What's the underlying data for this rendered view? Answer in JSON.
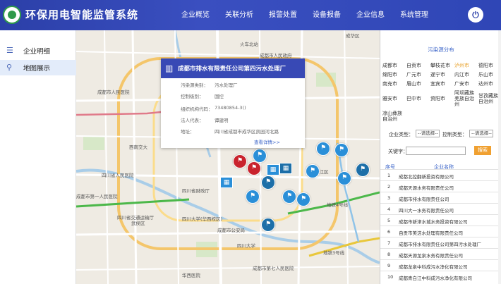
{
  "header": {
    "title": "环保用电智能监管系统",
    "nav": [
      "企业概览",
      "关联分析",
      "报警处置",
      "设备报备",
      "企业信息",
      "系统管理"
    ]
  },
  "sidebar": {
    "items": [
      {
        "label": "企业明细",
        "icon": "list-icon"
      },
      {
        "label": "地图展示",
        "icon": "map-icon"
      }
    ]
  },
  "map": {
    "labels": [
      "火车北站",
      "成都市人民医院",
      "西南交大",
      "四川省人民医院",
      "成都市第一人民医院",
      "四川大学",
      "华西医院",
      "四川省交通运输厅",
      "成都市公安局",
      "四川省财政厅",
      "武侯区",
      "锦江区",
      "成华区",
      "地铁4号线",
      "地铁3号线",
      "四川大学(华西校区)",
      "成都市人民政府",
      "成都市第七人民医院"
    ],
    "popup": {
      "title": "成都市排水有限责任公司第四污水处理厂",
      "rows": [
        {
          "key": "污染源类别：",
          "value": "污水处理厂"
        },
        {
          "key": "控制级别：",
          "value": "国控"
        },
        {
          "key": "组织机构代码：",
          "value": "73480854-3()"
        },
        {
          "key": "法人代表：",
          "value": "谭建明"
        },
        {
          "key": "地址：",
          "value": "四川省成都市成华区凯园河北路"
        }
      ],
      "more": "查看详情>>"
    }
  },
  "right_panel": {
    "title": "污染源分布",
    "cities": [
      "成都市",
      "自贡市",
      "攀枝花市",
      "泸州市",
      "德阳市",
      "绵阳市",
      "广元市",
      "遂宁市",
      "内江市",
      "乐山市",
      "南充市",
      "眉山市",
      "宜宾市",
      "广安市",
      "达州市",
      "雅安市",
      "巴中市",
      "资阳市",
      "阿坝藏族羌族自治州",
      "甘孜藏族自治州",
      "凉山彝族自治州"
    ],
    "selected_city": "泸州市",
    "filters": {
      "enterprise_type_label": "企业类型：",
      "enterprise_type_value": "--请选择--",
      "control_type_label": "控制类型：",
      "control_type_value": "--请选择--",
      "keyword_label": "关键字：",
      "keyword_value": "",
      "search_label": "搜索"
    },
    "table": {
      "col_no": "序号",
      "col_name": "企业名称",
      "rows": [
        {
          "no": "1",
          "name": "成都北控翻新投资有限公司"
        },
        {
          "no": "2",
          "name": "成都天源水务有限责任公司"
        },
        {
          "no": "3",
          "name": "成都市排水有限责任公司"
        },
        {
          "no": "4",
          "name": "四川大一水务有限责任公司"
        },
        {
          "no": "5",
          "name": "成都市新津水城水务投资有限公司"
        },
        {
          "no": "6",
          "name": "自贡市美洁水处理有限责任公司"
        },
        {
          "no": "7",
          "name": "成都市排水有限责任公司第四污水处理厂"
        },
        {
          "no": "8",
          "name": "成都天源龙泉水务有限责任公司"
        },
        {
          "no": "9",
          "name": "成都龙泉中科成污水净化有限公司"
        },
        {
          "no": "10",
          "name": "成都青白江中科成污水净化有限公司"
        }
      ]
    }
  },
  "colors": {
    "header_bg": "#2f46b6",
    "accent_blue": "#3b64c8",
    "marker_blue": "#2a8fd8",
    "marker_red": "#c9232d",
    "selected_city": "#e8a12a",
    "search_button": "#f0a030"
  }
}
